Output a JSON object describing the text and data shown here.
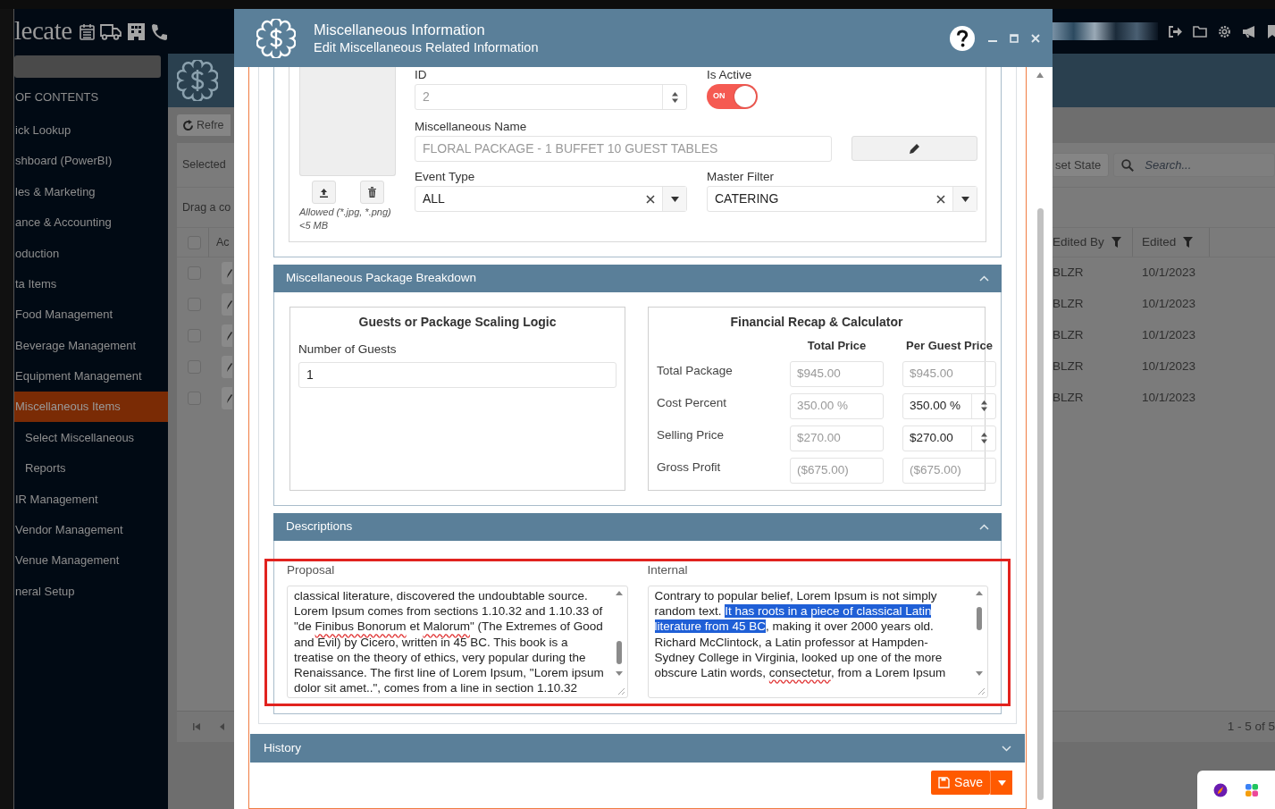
{
  "app_bar": {
    "logo": "lecate"
  },
  "sidebar": {
    "heading": "OF CONTENTS",
    "items": [
      {
        "label": "ick Lookup",
        "selected": false
      },
      {
        "label": "shboard (PowerBI)",
        "selected": false
      },
      {
        "label": "les & Marketing",
        "selected": false
      },
      {
        "label": "ance & Accounting",
        "selected": false
      },
      {
        "label": "oduction",
        "selected": false
      },
      {
        "label": "ta Items",
        "selected": false
      },
      {
        "label": "Food Management",
        "selected": false
      },
      {
        "label": "Beverage Management",
        "selected": false
      },
      {
        "label": "Equipment Management",
        "selected": false
      },
      {
        "label": "Miscellaneous Items",
        "selected": true,
        "children": [
          {
            "label": "Select Miscellaneous",
            "selected": false
          },
          {
            "label": "Reports",
            "selected": false
          }
        ]
      },
      {
        "label": "IR Management",
        "selected": false
      },
      {
        "label": "Vendor Management",
        "selected": false
      },
      {
        "label": "Venue Management",
        "selected": false
      },
      {
        "label": "neral Setup",
        "selected": false
      }
    ]
  },
  "grid": {
    "refresh_label": "Refre",
    "selected_label": "Selected",
    "group_hint": "Drag a co",
    "reset_label": "set State",
    "search_placeholder": "Search...",
    "pager": "1 - 5 of 5",
    "header_checked": false,
    "columns": [
      {
        "label": "Ac"
      },
      {
        "label": "Edited By"
      },
      {
        "label": "Edited"
      }
    ],
    "rows": [
      {
        "checked": false,
        "edited_by": "BLZR",
        "edited": "10/1/2023"
      },
      {
        "checked": false,
        "edited_by": "BLZR",
        "edited": "10/1/2023"
      },
      {
        "checked": false,
        "edited_by": "BLZR",
        "edited": "10/1/2023"
      },
      {
        "checked": false,
        "edited_by": "BLZR",
        "edited": "10/1/2023"
      },
      {
        "checked": false,
        "edited_by": "BLZR",
        "edited": "10/1/2023"
      }
    ]
  },
  "dialog": {
    "title": "Miscellaneous Information",
    "subtitle": "Edit Miscellaneous Related Information",
    "image_hint": "Allowed (*.jpg, *.png)",
    "size_hint": "<5 MB",
    "id": {
      "label": "ID",
      "value": "2",
      "disabled": true
    },
    "is_active": {
      "label": "Is Active",
      "on": true,
      "text": "ON"
    },
    "name": {
      "label": "Miscellaneous Name",
      "value": "FLORAL PACKAGE - 1 BUFFET 10 GUEST TABLES",
      "disabled": true
    },
    "event_type": {
      "label": "Event Type",
      "value": "ALL"
    },
    "master_filter": {
      "label": "Master Filter",
      "value": "CATERING"
    },
    "breakdown": {
      "title": "Miscellaneous Package Breakdown",
      "expanded": true,
      "scaling": {
        "title": "Guests or Package Scaling Logic",
        "label": "Number of Guests",
        "value": "1"
      },
      "recap": {
        "title": "Financial Recap & Calculator",
        "columns": [
          "Total Price",
          "Per Guest Price"
        ],
        "rows": [
          {
            "label": "Total Package",
            "total": "$945.00",
            "per_guest": "$945.00",
            "editable": false
          },
          {
            "label": "Cost Percent",
            "total": "350.00 %",
            "per_guest": "350.00 %",
            "editable": true
          },
          {
            "label": "Selling Price",
            "total": "$270.00",
            "per_guest": "$270.00",
            "editable": true
          },
          {
            "label": "Gross Profit",
            "total": "($675.00)",
            "per_guest": "($675.00)",
            "editable": false
          }
        ]
      }
    },
    "descriptions": {
      "title": "Descriptions",
      "expanded": true,
      "fields": [
        {
          "label": "Proposal",
          "segments": [
            {
              "kind": "plain",
              "text": "classical literature, discovered the undoubtable source. Lorem Ipsum comes from sections 1.10.32 and 1.10.33 of \"de "
            },
            {
              "kind": "spelling",
              "text": "Finibus Bonorum"
            },
            {
              "kind": "plain",
              "text": " et "
            },
            {
              "kind": "spelling",
              "text": "Malorum"
            },
            {
              "kind": "plain",
              "text": "\" (The Extremes of Good and Evil) by Cicero, written in 45 BC. This book is a treatise on the theory of ethics, very popular during the Renaissance. The first line of Lorem Ipsum, \"Lorem ipsum dolor sit amet..\", comes from a line in section 1.10.32"
            }
          ]
        },
        {
          "label": "Internal",
          "segments": [
            {
              "kind": "plain",
              "text": "Contrary to popular belief, Lorem Ipsum is not simply random text. "
            },
            {
              "kind": "selection",
              "text": "It has roots in a piece of classical Latin literature from 45 BC"
            },
            {
              "kind": "plain",
              "text": ", making it over 2000 years old. Richard McClintock, a Latin professor at Hampden-Sydney College in Virginia, looked up one of the more obscure Latin words, "
            },
            {
              "kind": "spelling",
              "text": "consectetur"
            },
            {
              "kind": "plain",
              "text": ", from a Lorem Ipsum"
            }
          ]
        }
      ]
    },
    "history": {
      "title": "History",
      "expanded": false
    },
    "save_label": "Save"
  }
}
